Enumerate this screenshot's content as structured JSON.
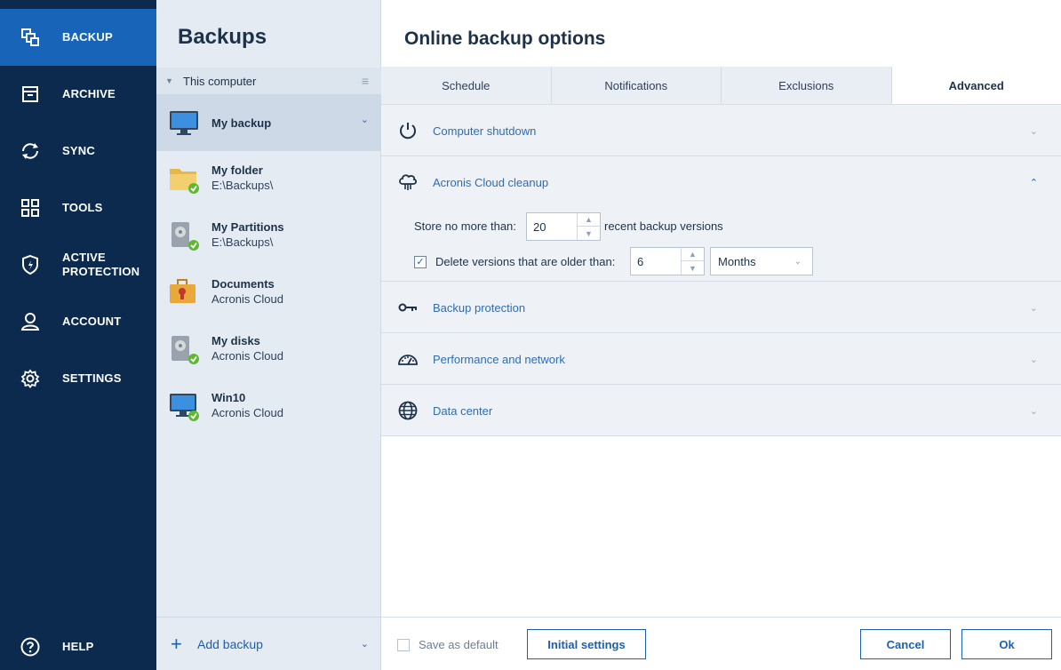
{
  "nav": {
    "items": [
      {
        "label": "BACKUP",
        "icon": "backup-icon",
        "active": true
      },
      {
        "label": "ARCHIVE",
        "icon": "archive-icon"
      },
      {
        "label": "SYNC",
        "icon": "sync-icon"
      },
      {
        "label": "TOOLS",
        "icon": "tools-icon"
      },
      {
        "label": "ACTIVE\nPROTECTION",
        "icon": "shield-icon"
      },
      {
        "label": "ACCOUNT",
        "icon": "account-icon"
      },
      {
        "label": "SETTINGS",
        "icon": "gear-icon"
      }
    ],
    "help": {
      "label": "HELP",
      "icon": "help-icon"
    }
  },
  "backups": {
    "title": "Backups",
    "group": "This computer",
    "items": [
      {
        "name": "My backup",
        "sub": "",
        "icon": "monitor-icon"
      },
      {
        "name": "My folder",
        "sub": "E:\\Backups\\",
        "icon": "folder-icon"
      },
      {
        "name": "My Partitions",
        "sub": "E:\\Backups\\",
        "icon": "disk-icon"
      },
      {
        "name": "Documents",
        "sub": "Acronis Cloud",
        "icon": "briefcase-icon"
      },
      {
        "name": "My disks",
        "sub": "Acronis Cloud",
        "icon": "disk-icon"
      },
      {
        "name": "Win10",
        "sub": "Acronis Cloud",
        "icon": "monitor-icon"
      }
    ],
    "add_label": "Add backup"
  },
  "options": {
    "title": "Online backup options",
    "tabs": [
      "Schedule",
      "Notifications",
      "Exclusions",
      "Advanced"
    ],
    "active_tab": "Advanced",
    "sections": {
      "shutdown": "Computer shutdown",
      "cleanup": "Acronis Cloud cleanup",
      "protection": "Backup protection",
      "performance": "Performance and network",
      "datacenter": "Data center"
    },
    "cleanup": {
      "store_label": "Store no more than:",
      "store_value": "20",
      "store_suffix": "recent backup versions",
      "delete_label": "Delete versions that are older than:",
      "delete_value": "6",
      "delete_checked": true,
      "unit": "Months"
    },
    "footer": {
      "save_default": "Save as default",
      "initial": "Initial settings",
      "cancel": "Cancel",
      "ok": "Ok"
    }
  },
  "colors": {
    "nav_bg": "#0c2a4d",
    "nav_active": "#1764b8",
    "accent": "#1d5fb0",
    "ok_green": "#5fb832"
  }
}
